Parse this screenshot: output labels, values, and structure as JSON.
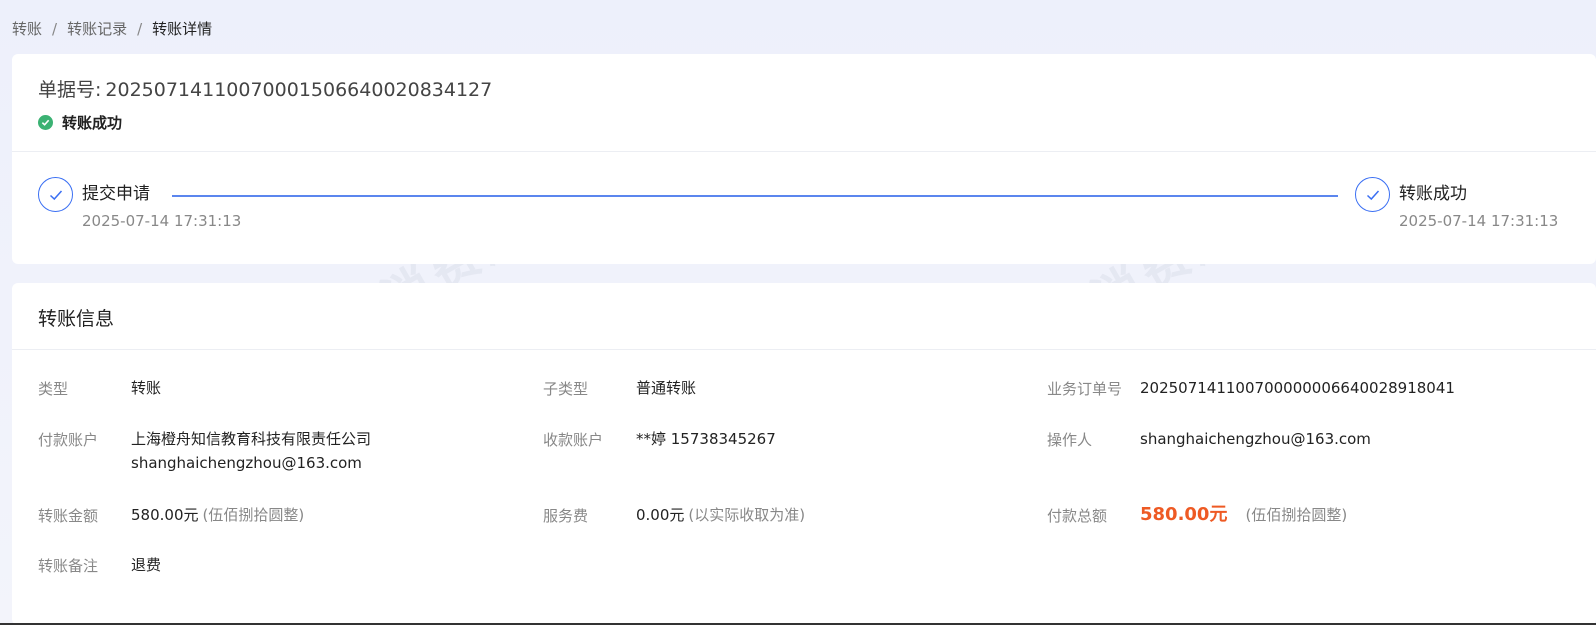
{
  "breadcrumb": {
    "items": [
      "转账",
      "转账记录",
      "转账详情"
    ],
    "separator": "/"
  },
  "header": {
    "bill_label": "单据号:",
    "bill_no": "20250714110070001506640020834127",
    "status": "转账成功",
    "status_color": "#3bb273"
  },
  "steps": [
    {
      "name": "提交申请",
      "time": "2025-07-14 17:31:13"
    },
    {
      "name": "转账成功",
      "time": "2025-07-14 17:31:13"
    }
  ],
  "info": {
    "title": "转账信息",
    "type_label": "类型",
    "type_value": "转账",
    "subtype_label": "子类型",
    "subtype_value": "普通转账",
    "order_label": "业务订单号",
    "order_value": "2025071411007000000066400289180​41",
    "payer_label": "付款账户",
    "payer_value_1": "上海橙舟知信教育科技有限责任公司",
    "payer_value_2": "shanghaichengzhou@163.com",
    "payee_label": "收款账户",
    "payee_value": "**婷 15738345267",
    "operator_label": "操作人",
    "operator_value": "shanghaichengzhou@163.com",
    "amount_label": "转账金额",
    "amount_value": "580.00元",
    "amount_note": "(伍佰捌拾圆整)",
    "fee_label": "服务费",
    "fee_value": "0.00元",
    "fee_note": "(以实际收取为准)",
    "total_label": "付款总额",
    "total_value": "580.00元",
    "total_note": "(伍佰捌拾圆整)",
    "remark_label": "转账备注",
    "remark_value": "退费"
  },
  "watermark_text": "消费保 您身边的消费服务管家",
  "colors": {
    "accent": "#3a6ff3",
    "amount": "#ee5a24"
  }
}
